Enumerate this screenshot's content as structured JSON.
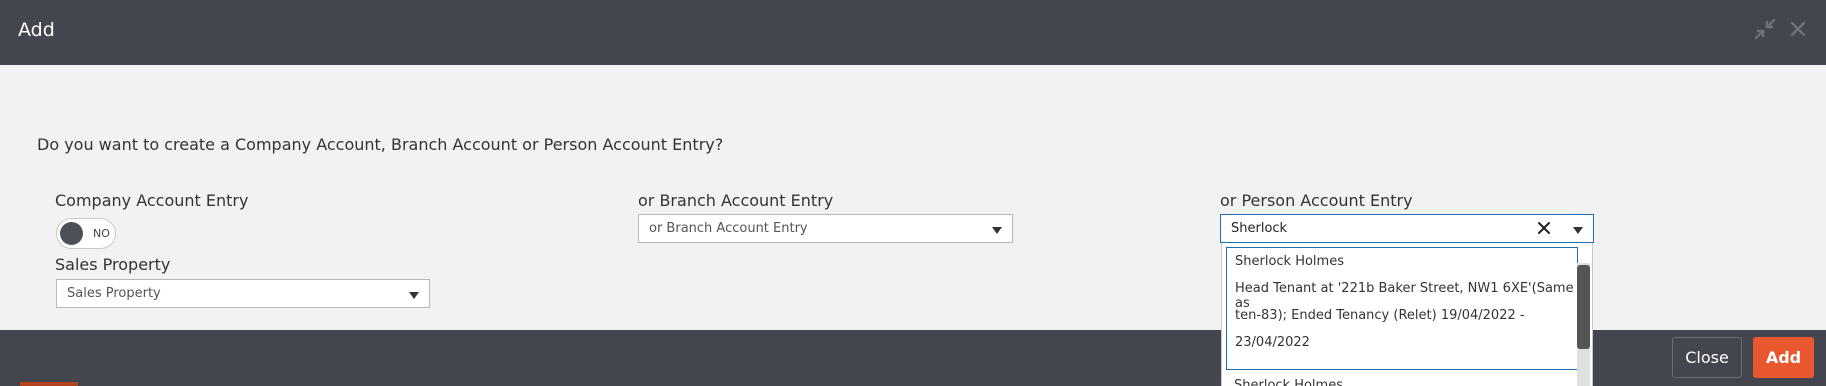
{
  "dialog": {
    "title": "Add",
    "collapse_icon": "collapse-icon",
    "close_icon": "close-icon"
  },
  "form": {
    "prompt": "Do you want to create a Company Account, Branch Account or Person Account Entry?",
    "company": {
      "label": "Company Account Entry",
      "toggle_text": "NO"
    },
    "sales_property": {
      "label": "Sales Property",
      "value": "Sales Property"
    },
    "branch": {
      "label": "or Branch Account Entry",
      "value": "or Branch Account Entry"
    },
    "person": {
      "label": "or Person Account Entry",
      "value": "Sherlock",
      "options": [
        {
          "name": "Sherlock Holmes",
          "lines": [
            "Head Tenant at '221b Baker Street, NW1 6XE'(Same as",
            "ten-83); Ended Tenancy (Relet) 19/04/2022 -",
            "23/04/2022"
          ]
        },
        {
          "name": "Sherlock Holmes"
        }
      ]
    }
  },
  "footer": {
    "close_label": "Close",
    "add_label": "Add"
  },
  "colors": {
    "header_bg": "#43464f",
    "accent": "#e8572e",
    "focus": "#1a6fb0"
  }
}
